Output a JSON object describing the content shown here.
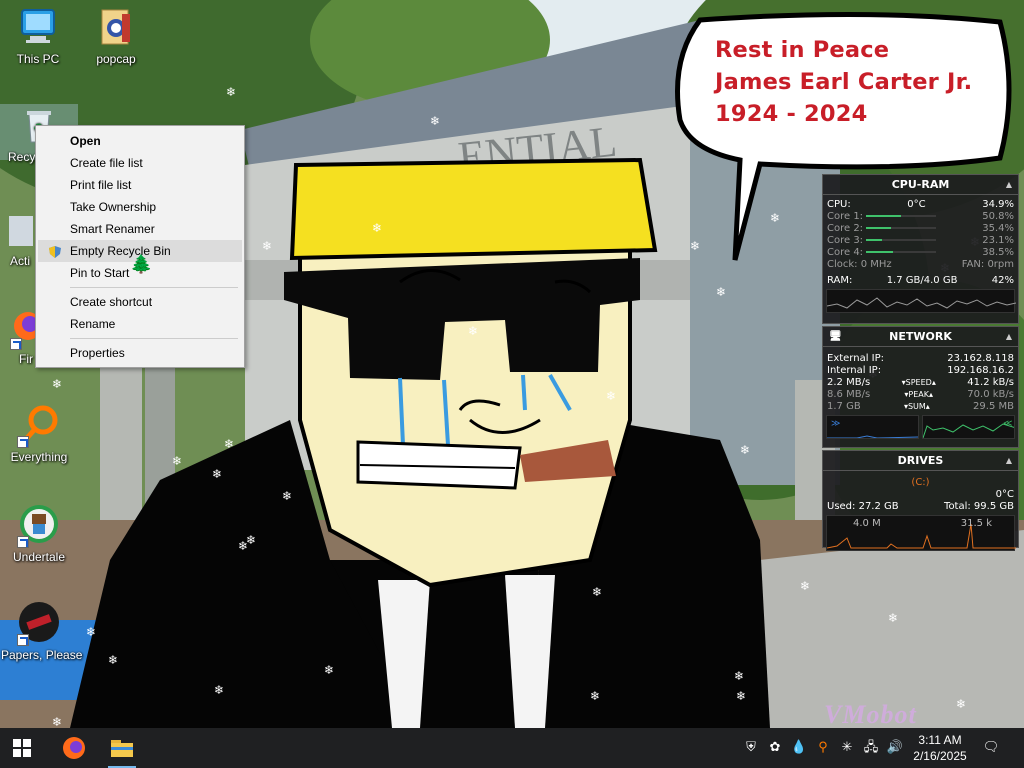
{
  "bubble": {
    "line1": "Rest in Peace",
    "line2": "James Earl Carter Jr.",
    "line3": "1924 - 2024"
  },
  "wallpaper": {
    "building_sign": "ENTIAL",
    "watermark": "VMobot"
  },
  "desktop_icons": [
    {
      "label": "This PC",
      "icon": "computer-icon"
    },
    {
      "label": "popcap",
      "icon": "folder-icon"
    },
    {
      "label": "Recy",
      "icon": "recycle-bin-icon"
    },
    {
      "label": "Acti",
      "icon": "app-icon"
    },
    {
      "label": "Fir",
      "icon": "firefox-icon"
    },
    {
      "label": "Everything",
      "icon": "search-magnifier-icon"
    },
    {
      "label": "Undertale",
      "icon": "undertale-icon"
    },
    {
      "label": "Papers, Please",
      "icon": "papers-please-icon"
    }
  ],
  "context_menu": {
    "items": [
      {
        "label": "Open",
        "bold": true
      },
      {
        "label": "Create file list"
      },
      {
        "label": "Print file list"
      },
      {
        "label": "Take Ownership"
      },
      {
        "label": "Smart Renamer"
      },
      {
        "label": "Empty Recycle Bin",
        "hover": true,
        "icon": "shield-icon"
      },
      {
        "label": "Pin to Start"
      },
      {
        "label": "Create shortcut"
      },
      {
        "label": "Rename"
      },
      {
        "label": "Properties"
      }
    ]
  },
  "cpu_ram": {
    "title": "CPU-RAM",
    "cpu_label": "CPU:",
    "cpu_temp": "0°C",
    "cpu_value": "34.9%",
    "cores": [
      {
        "label": "Core 1:",
        "value": "50.8%",
        "level": 0.508
      },
      {
        "label": "Core 2:",
        "value": "35.4%",
        "level": 0.354
      },
      {
        "label": "Core 3:",
        "value": "23.1%",
        "level": 0.231
      },
      {
        "label": "Core 4:",
        "value": "38.5%",
        "level": 0.385
      }
    ],
    "clock": "Clock: 0 MHz",
    "fan": "FAN: 0rpm",
    "ram_label": "RAM:",
    "ram_value": "1.7 GB/4.0 GB",
    "ram_pct": "42%"
  },
  "network": {
    "title": "NETWORK",
    "external_label": "External IP:",
    "external_ip": "23.162.8.118",
    "internal_label": "Internal IP:",
    "internal_ip": "192.168.16.2",
    "rows": [
      {
        "left": "2.2 MB/s",
        "mid": "SPEED",
        "right": "41.2 kB/s"
      },
      {
        "left": "8.6 MB/s",
        "mid": "PEAK",
        "right": "70.0 kB/s"
      },
      {
        "left": "1.7 GB",
        "mid": "SUM",
        "right": "29.5 MB"
      }
    ]
  },
  "drives": {
    "title": "DRIVES",
    "drive": "(C:)",
    "temp": "0°C",
    "used": "Used: 27.2 GB",
    "total": "Total: 99.5 GB",
    "read": "4.0 M",
    "write": "31.5 k"
  },
  "taskbar": {
    "clock_time": "3:11 AM",
    "clock_date": "2/16/2025"
  },
  "colors": {
    "accent": "#76b9ed",
    "bubble_text": "#c81e28",
    "graph_green": "#3fc26b",
    "graph_orange": "#e07020"
  }
}
